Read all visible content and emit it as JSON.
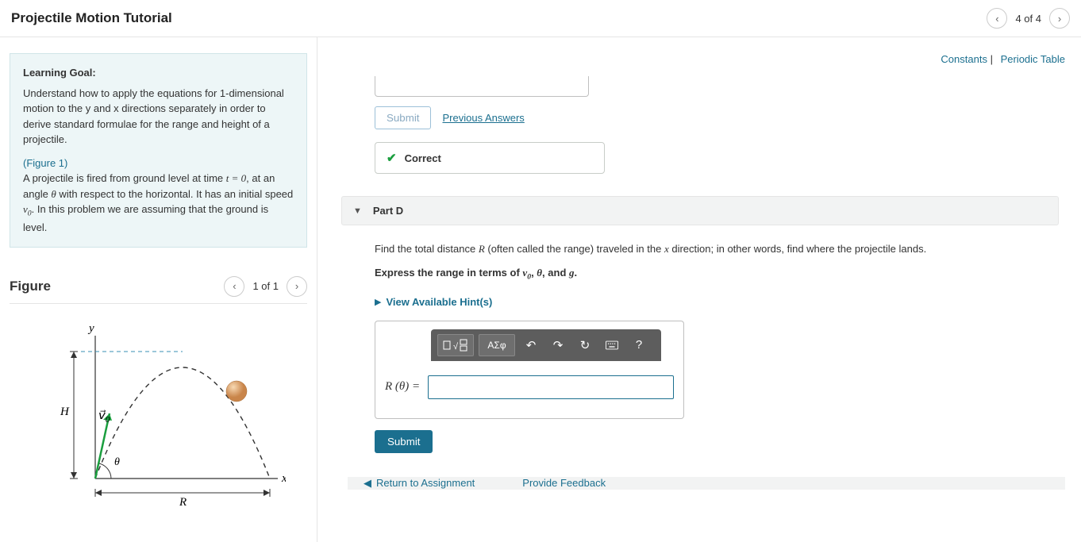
{
  "header": {
    "title": "Projectile Motion Tutorial",
    "nav": {
      "position": "4 of 4"
    }
  },
  "goal": {
    "label": "Learning Goal:",
    "text": "Understand how to apply the equations for 1-dimensional motion to the y and x directions separately in order to derive standard formulae for the range and height of a projectile.",
    "fig_link": "(Figure 1)",
    "problem_prefix": "A projectile is fired from ground level at time ",
    "problem_eq": "t = 0",
    "problem_mid": ", at an angle ",
    "problem_theta": "θ",
    "problem_mid2": " with respect to the horizontal. It has an initial speed ",
    "problem_v0": "v",
    "problem_sub0": "0",
    "problem_end": ". In this problem we are assuming that the ground is level."
  },
  "figure": {
    "title": "Figure",
    "position": "1 of 1",
    "labels": {
      "y": "y",
      "x": "x",
      "H": "H",
      "R": "R",
      "theta": "θ",
      "v0_arrow": "v⃗",
      "v0_sub": "0"
    }
  },
  "rightLinks": {
    "constants": "Constants",
    "periodic": "Periodic Table"
  },
  "prevPart": {
    "submit": "Submit",
    "previous_answers": "Previous Answers",
    "correct": "Correct"
  },
  "partD": {
    "label": "Part D",
    "question_a": "Find the total distance ",
    "question_R": "R",
    "question_b": " (often called the range) traveled in the ",
    "question_x": "x",
    "question_c": " direction; in other words, find where the projectile lands.",
    "instr_a": "Express the range in terms of ",
    "instr_v0": "v",
    "instr_sub0": "0",
    "instr_mid": ", ",
    "instr_theta": "θ",
    "instr_mid2": ", and ",
    "instr_g": "g",
    "instr_end": ".",
    "hints": "View Available Hint(s)",
    "answer_label": "R (θ) = ",
    "toolbar": {
      "greek": "ΑΣφ"
    },
    "submit": "Submit"
  },
  "footer": {
    "return": "Return to Assignment",
    "feedback": "Provide Feedback"
  }
}
